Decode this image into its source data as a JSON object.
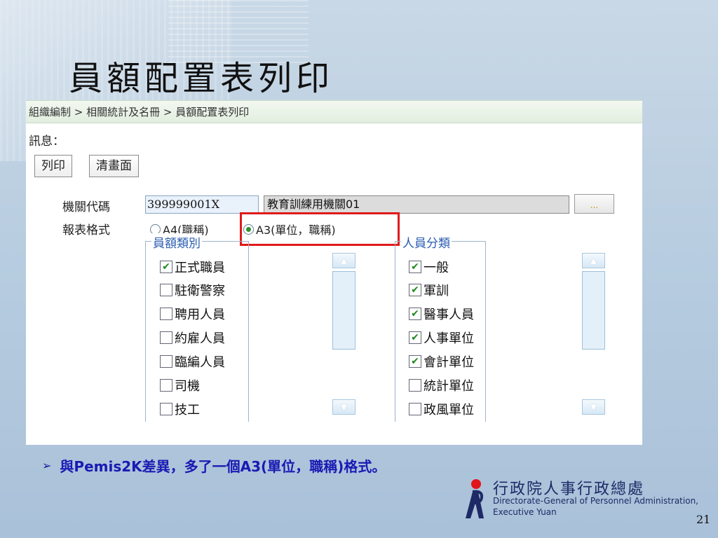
{
  "slide": {
    "title": "員額配置表列印",
    "bullet": "與Pemis2K差異，多了一個A3(單位，職稱)格式。",
    "page_number": "21"
  },
  "app": {
    "breadcrumb": "組織編制 > 相關統計及名冊 > 員額配置表列印",
    "message_label": "訊息：",
    "buttons": {
      "print": "列印",
      "clear": "清畫面"
    },
    "form": {
      "org_code_label": "機關代碼",
      "org_code_value": "399999001X",
      "org_name_value": "教育訓練用機關01",
      "picker_label": "...",
      "format_label": "報表格式",
      "format_options": [
        {
          "label": "A4(職稱)",
          "selected": false
        },
        {
          "label": "A3(單位，職稱)",
          "selected": true
        }
      ]
    },
    "staff_category": {
      "legend": "員額類別",
      "items": [
        {
          "label": "正式職員",
          "checked": true
        },
        {
          "label": "駐衛警察",
          "checked": false
        },
        {
          "label": "聘用人員",
          "checked": false
        },
        {
          "label": "約雇人員",
          "checked": false
        },
        {
          "label": "臨編人員",
          "checked": false
        },
        {
          "label": "司機",
          "checked": false
        },
        {
          "label": "技工",
          "checked": false
        }
      ]
    },
    "personnel_category": {
      "legend": "人員分類",
      "items": [
        {
          "label": "一般",
          "checked": true
        },
        {
          "label": "軍訓",
          "checked": true
        },
        {
          "label": "醫事人員",
          "checked": true
        },
        {
          "label": "人事單位",
          "checked": true
        },
        {
          "label": "會計單位",
          "checked": true
        },
        {
          "label": "統計單位",
          "checked": false
        },
        {
          "label": "政風單位",
          "checked": false
        }
      ]
    }
  },
  "logo": {
    "chinese": "行政院人事行政總處",
    "english_line1": "Directorate-General of Personnel Administration,",
    "english_line2": "Executive Yuan"
  },
  "colors": {
    "accent_red": "#e01a1a",
    "legend_blue": "#2a5db0",
    "bullet_blue": "#1a1ab3",
    "check_green": "#1e8a1e"
  },
  "icons": [
    "radio-icon",
    "checkbox-icon",
    "scroll-up-icon",
    "scroll-down-icon",
    "bullet-arrow-icon",
    "logo-mark-icon"
  ]
}
